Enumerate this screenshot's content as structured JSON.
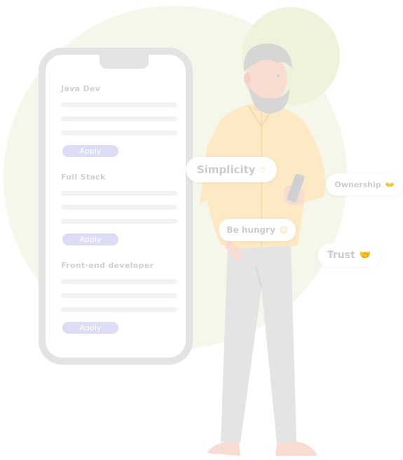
{
  "jobs": [
    {
      "title": "Java Dev",
      "apply_label": "Apply"
    },
    {
      "title": "Full Stack",
      "apply_label": "Apply"
    },
    {
      "title": "Front-end developer",
      "apply_label": "Apply"
    }
  ],
  "values": {
    "simplicity": {
      "label": "Simplicity",
      "icon": "hand-pointing-icon"
    },
    "ownership": {
      "label": "Ownership",
      "icon": "open-hands-icon"
    },
    "be_hungry": {
      "label": "Be hungry",
      "icon": "grinning-face-icon"
    },
    "trust": {
      "label": "Trust",
      "icon": "handshake-icon"
    }
  },
  "colors": {
    "background_circle": "#f4f7e9",
    "phone_frame": "#e2e3e3",
    "apply_button": "#dcdcf7",
    "shirt": "#fde9c4",
    "pants": "#e3e4e4"
  }
}
